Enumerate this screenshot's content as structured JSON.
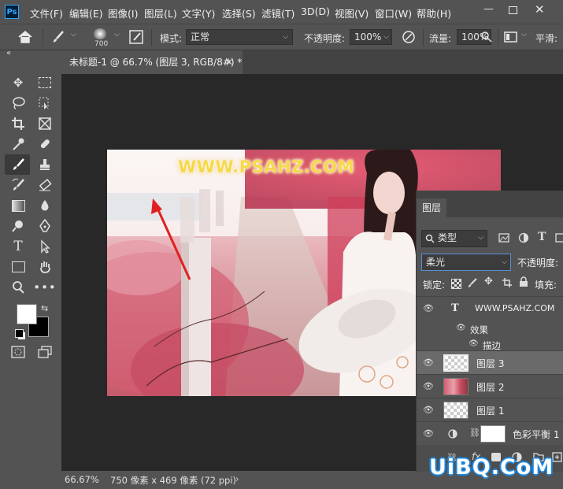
{
  "app": {
    "logo": "Ps"
  },
  "menu": [
    "文件(F)",
    "编辑(E)",
    "图像(I)",
    "图层(L)",
    "文字(Y)",
    "选择(S)",
    "滤镜(T)",
    "3D(D)",
    "视图(V)",
    "窗口(W)",
    "帮助(H)"
  ],
  "options": {
    "brush_size": "700",
    "mode_label": "模式:",
    "mode_value": "正常",
    "opacity_label": "不透明度:",
    "opacity_value": "100%",
    "flow_label": "流量:",
    "flow_value": "100%",
    "smooth_label": "平滑:"
  },
  "document": {
    "tab_title": "未标题-1 @ 66.7% (图层 3, RGB/8#) *"
  },
  "status": {
    "zoom": "66.67%",
    "doc_info": "750 像素 x 469 像素 (72 ppi)"
  },
  "colors": {
    "foreground": "#ffffff",
    "background": "#000000",
    "accent": "#31a8ff"
  },
  "canvas_watermark": "WWW.PSAHZ.COM",
  "layers_panel": {
    "tab": "图层",
    "filter_label": "类型",
    "blend_mode": "柔光",
    "opacity_label": "不透明度:",
    "lock_label": "锁定:",
    "fill_label": "填充:",
    "layers": [
      {
        "name": "WWW.PSAHZ.COM",
        "type": "text"
      },
      {
        "name": "效果",
        "type": "effects"
      },
      {
        "name": "描边",
        "type": "effect-item"
      },
      {
        "name": "图层 3",
        "type": "pixel",
        "selected": true
      },
      {
        "name": "图层 2",
        "type": "photo"
      },
      {
        "name": "图层 1",
        "type": "pixel"
      },
      {
        "name": "色彩平衡 1",
        "type": "adjustment"
      }
    ]
  },
  "site_watermark": "UiBQ.CoM"
}
